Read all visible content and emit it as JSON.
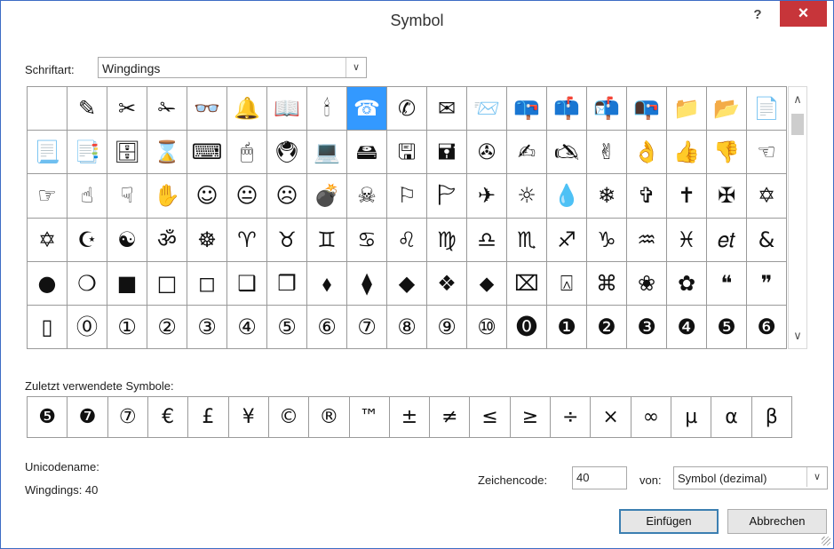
{
  "title": "Symbol",
  "titlebar": {
    "help": "?",
    "close": "×"
  },
  "font": {
    "label": "Schriftart:",
    "value": "Wingdings"
  },
  "grid": {
    "rows": [
      [
        " ",
        "✎",
        "✂",
        "✁",
        "👓",
        "🔔",
        "📖",
        "🕯",
        "☎",
        "✆",
        "✉",
        "📨",
        "📪",
        "📫",
        "📬",
        "📭",
        "📁",
        "📂",
        "📄"
      ],
      [
        "📃",
        "📑",
        "🗄",
        "⌛",
        "⌨",
        "🖱",
        "🖲",
        "💻",
        "🖴",
        "🖫",
        "🖬",
        "✇",
        "✍",
        "🖎",
        "✌",
        "👌",
        "👍",
        "👎",
        "☜"
      ],
      [
        "☞",
        "☝",
        "☟",
        "✋",
        "☺",
        "😐",
        "☹",
        "💣",
        "☠",
        "⚐",
        "🏱",
        "✈",
        "☼",
        "💧",
        "❄",
        "✞",
        "✝",
        "✠",
        "✡"
      ],
      [
        "✡",
        "☪",
        "☯",
        "ॐ",
        "☸",
        "♈",
        "♉",
        "♊",
        "♋",
        "♌",
        "♍",
        "♎",
        "♏",
        "♐",
        "♑",
        "♒",
        "♓",
        "𝑒𝑡",
        "&"
      ],
      [
        "●",
        "❍",
        "■",
        "□",
        "◻",
        "❑",
        "❒",
        "⬧",
        "⧫",
        "◆",
        "❖",
        "⬥",
        "⌧",
        "⍓",
        "⌘",
        "❀",
        "✿",
        "❝",
        "❞"
      ],
      [
        "▯",
        "⓪",
        "①",
        "②",
        "③",
        "④",
        "⑤",
        "⑥",
        "⑦",
        "⑧",
        "⑨",
        "⑩",
        "⓿",
        "❶",
        "❷",
        "❸",
        "❹",
        "❺",
        "❻"
      ]
    ],
    "selected": "☎"
  },
  "recent": {
    "label": "Zuletzt verwendete Symbole:",
    "symbols": [
      "❺",
      "❼",
      "⑦",
      "€",
      "£",
      "¥",
      "©",
      "®",
      "™",
      "±",
      "≠",
      "≤",
      "≥",
      "÷",
      "×",
      "∞",
      "µ",
      "α",
      "β"
    ]
  },
  "unicode": {
    "label": "Unicodename:",
    "value": "Wingdings: 40"
  },
  "charcode": {
    "label": "Zeichencode:",
    "value": "40"
  },
  "from": {
    "label": "von:",
    "value": "Symbol (dezimal)"
  },
  "buttons": {
    "insert": "Einfügen",
    "cancel": "Abbrechen"
  }
}
